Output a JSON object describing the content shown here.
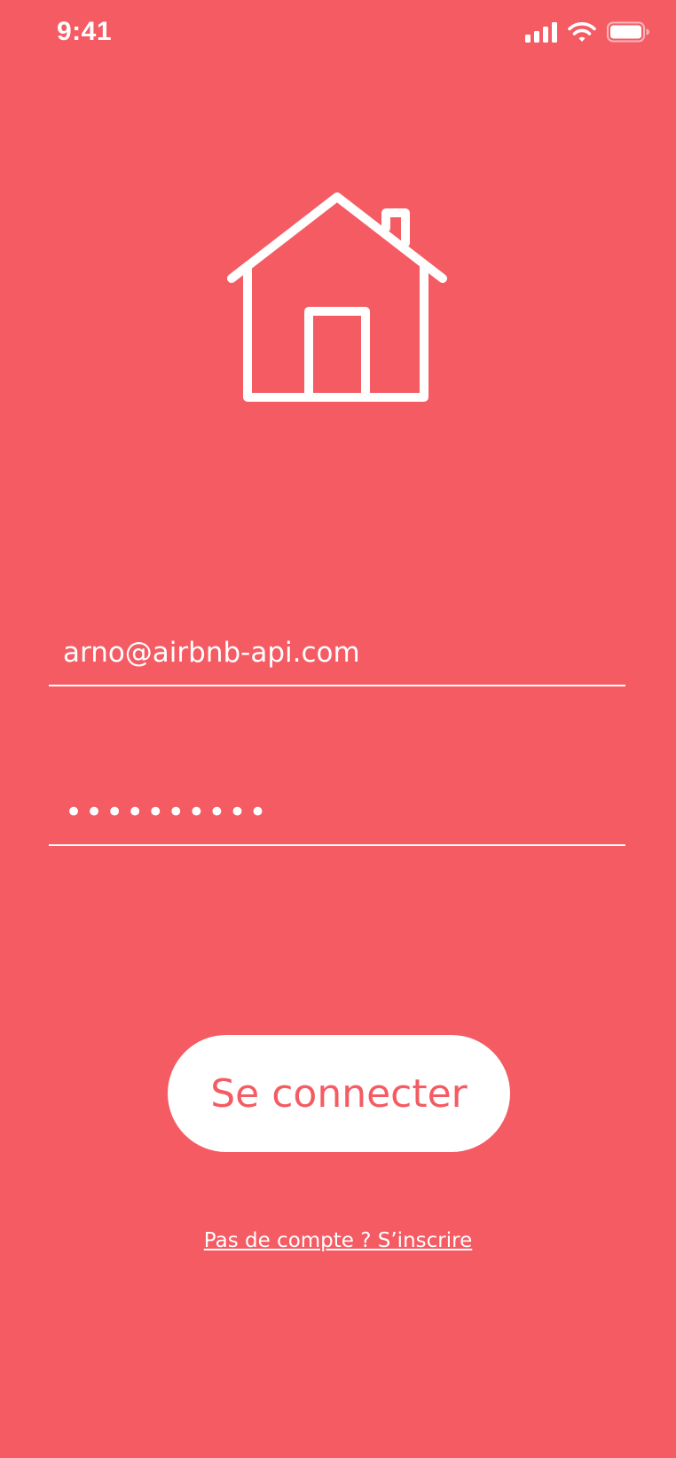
{
  "status_bar": {
    "time": "9:41",
    "icons": [
      "cellular-signal-icon",
      "wifi-icon",
      "battery-icon"
    ]
  },
  "logo": {
    "icon": "house-icon"
  },
  "form": {
    "email_value": "arno@airbnb-api.com",
    "password_value": "••••••••••",
    "submit_label": "Se connecter",
    "signup_link": "Pas de compte ? S’inscrire"
  },
  "colors": {
    "background": "#F45B63",
    "foreground": "#FFFFFF",
    "button_text": "#F45B63"
  }
}
